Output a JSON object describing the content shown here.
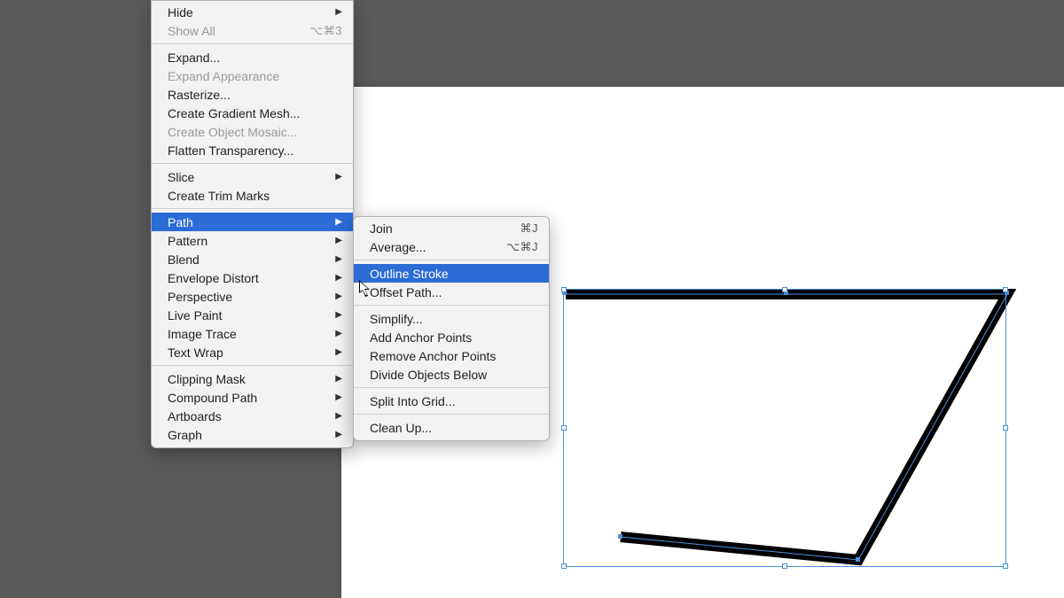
{
  "colors": {
    "highlight": "#2b6cd6",
    "menu_bg": "#f2f2f2"
  },
  "menu": {
    "groups": [
      [
        {
          "label": "Hide",
          "submenu": true,
          "disabled": false,
          "shortcut": ""
        },
        {
          "label": "Show All",
          "submenu": false,
          "disabled": true,
          "shortcut": "⌥⌘3"
        }
      ],
      [
        {
          "label": "Expand...",
          "submenu": false,
          "disabled": false,
          "shortcut": ""
        },
        {
          "label": "Expand Appearance",
          "submenu": false,
          "disabled": true,
          "shortcut": ""
        },
        {
          "label": "Rasterize...",
          "submenu": false,
          "disabled": false,
          "shortcut": ""
        },
        {
          "label": "Create Gradient Mesh...",
          "submenu": false,
          "disabled": false,
          "shortcut": ""
        },
        {
          "label": "Create Object Mosaic...",
          "submenu": false,
          "disabled": true,
          "shortcut": ""
        },
        {
          "label": "Flatten Transparency...",
          "submenu": false,
          "disabled": false,
          "shortcut": ""
        }
      ],
      [
        {
          "label": "Slice",
          "submenu": true,
          "disabled": false,
          "shortcut": ""
        },
        {
          "label": "Create Trim Marks",
          "submenu": false,
          "disabled": false,
          "shortcut": ""
        }
      ],
      [
        {
          "label": "Path",
          "submenu": true,
          "disabled": false,
          "shortcut": "",
          "highlight": true
        },
        {
          "label": "Pattern",
          "submenu": true,
          "disabled": false,
          "shortcut": ""
        },
        {
          "label": "Blend",
          "submenu": true,
          "disabled": false,
          "shortcut": ""
        },
        {
          "label": "Envelope Distort",
          "submenu": true,
          "disabled": false,
          "shortcut": ""
        },
        {
          "label": "Perspective",
          "submenu": true,
          "disabled": false,
          "shortcut": ""
        },
        {
          "label": "Live Paint",
          "submenu": true,
          "disabled": false,
          "shortcut": ""
        },
        {
          "label": "Image Trace",
          "submenu": true,
          "disabled": false,
          "shortcut": ""
        },
        {
          "label": "Text Wrap",
          "submenu": true,
          "disabled": false,
          "shortcut": ""
        }
      ],
      [
        {
          "label": "Clipping Mask",
          "submenu": true,
          "disabled": false,
          "shortcut": ""
        },
        {
          "label": "Compound Path",
          "submenu": true,
          "disabled": false,
          "shortcut": ""
        },
        {
          "label": "Artboards",
          "submenu": true,
          "disabled": false,
          "shortcut": ""
        },
        {
          "label": "Graph",
          "submenu": true,
          "disabled": false,
          "shortcut": ""
        }
      ]
    ]
  },
  "submenu": {
    "groups": [
      [
        {
          "label": "Join",
          "shortcut": "⌘J",
          "highlight": false
        },
        {
          "label": "Average...",
          "shortcut": "⌥⌘J",
          "highlight": false
        }
      ],
      [
        {
          "label": "Outline Stroke",
          "shortcut": "",
          "highlight": true
        },
        {
          "label": "Offset Path...",
          "shortcut": "",
          "highlight": false
        }
      ],
      [
        {
          "label": "Simplify...",
          "shortcut": "",
          "highlight": false
        },
        {
          "label": "Add Anchor Points",
          "shortcut": "",
          "highlight": false
        },
        {
          "label": "Remove Anchor Points",
          "shortcut": "",
          "highlight": false
        },
        {
          "label": "Divide Objects Below",
          "shortcut": "",
          "highlight": false
        }
      ],
      [
        {
          "label": "Split Into Grid...",
          "shortcut": "",
          "highlight": false
        }
      ],
      [
        {
          "label": "Clean Up...",
          "shortcut": "",
          "highlight": false
        }
      ]
    ]
  }
}
